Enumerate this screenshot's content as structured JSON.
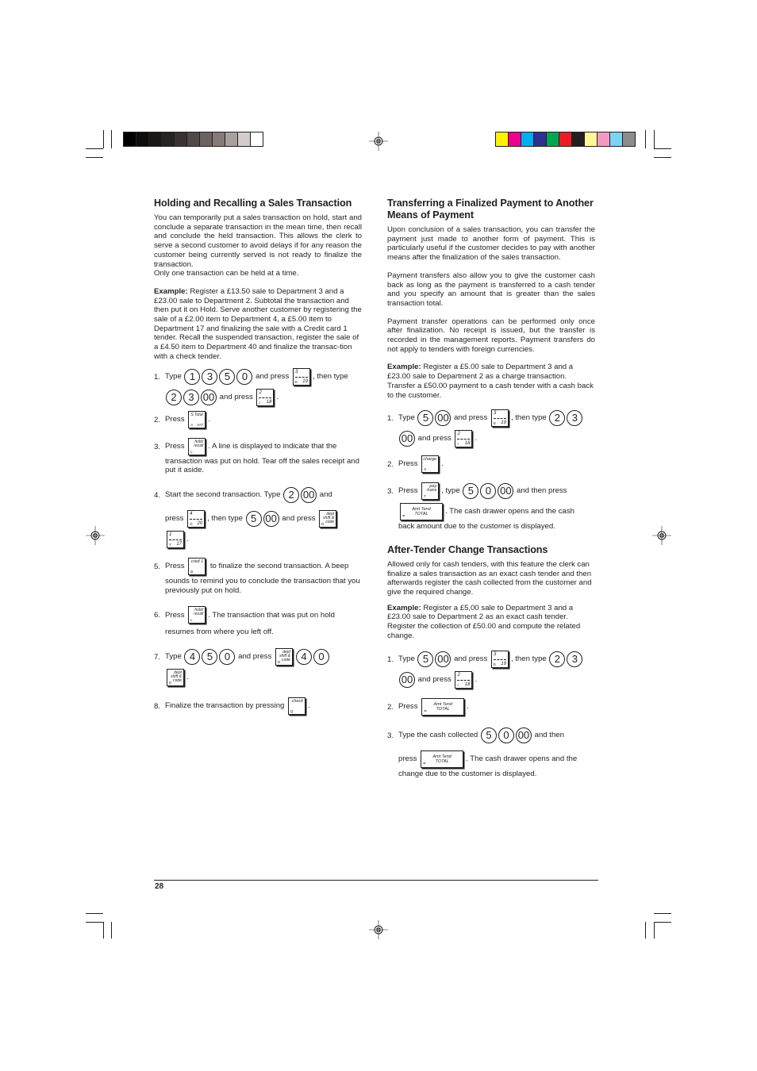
{
  "page": {
    "number": "28"
  },
  "print_marks": {
    "gray_swatches": [
      "#000000",
      "#0e0c0c",
      "#1a1715",
      "#272320",
      "#393331",
      "#514947",
      "#6c6360",
      "#857b78",
      "#a7a09d",
      "#d4cdcb",
      "#ffffff"
    ],
    "color_swatches": [
      "#fff200",
      "#ec008c",
      "#00aeef",
      "#2e3192",
      "#00a651",
      "#ed1c24",
      "#231f20",
      "#fff799",
      "#f49ac1",
      "#7dd3f7",
      "#8d8b8c"
    ]
  },
  "left": {
    "heading": "Holding and Recalling a Sales Transaction",
    "intro": "You can temporarily put a sales transaction on hold, start and conclude a separate transaction in the mean time, then recall and conclude the held transaction. This allows the clerk to serve a second customer to avoid delays if for any reason the customer being currently served is not ready to finalize the transaction.",
    "intro2": "Only one transaction can be held at a time.",
    "example_label": "Example:",
    "example_text": " Register a £13.50 sale to Department 3 and a £23.00 sale to Department 2. Subtotal the transaction and then put it on Hold. Serve another customer by registering the sale of a £2.00 item to Department 4, a £5.00 item to Department 17 and finalizing the sale with a Credit card 1 tender. Recall the suspended transaction, register the sale of a £4.50 item to Department 40 and finalize the transac-tion with a check tender.",
    "steps": {
      "s1": {
        "num": "1.",
        "a": "Type ",
        "keys1": [
          "1",
          "3",
          "5",
          "0"
        ],
        "b": " and press ",
        "c": ", then type",
        "keys2": [
          "2",
          "3",
          "00"
        ],
        "d": " and press ",
        "e": "."
      },
      "s2": {
        "num": "2.",
        "a": "Press ",
        "b": "."
      },
      "s3": {
        "num": "3.",
        "a": "Press ",
        "b": ". A line is displayed to indicate that the",
        "c": "transaction was put on hold. Tear off the sales receipt and put it aside."
      },
      "s4": {
        "num": "4.",
        "a": "Start the second transaction. Type ",
        "keys1": [
          "2",
          "00"
        ],
        "b": " and",
        "c": "press ",
        "d": ", then type ",
        "keys2": [
          "5",
          "00"
        ],
        "e": " and press ",
        "f": "."
      },
      "s5": {
        "num": "5.",
        "a": "Press ",
        "b": " to finalize the second transaction. A beep",
        "c": "sounds to remind you to conclude the transaction that you previously put on hold."
      },
      "s6": {
        "num": "6.",
        "a": "Press ",
        "b": ". The transaction that was put on hold",
        "c": "resumes from where you left off."
      },
      "s7": {
        "num": "7.",
        "a": "Type ",
        "keys1": [
          "4",
          "5",
          "0"
        ],
        "b": " and press ",
        "keys2": [
          "4",
          "0"
        ],
        "c": "."
      },
      "s8": {
        "num": "8.",
        "a": "Finalize the transaction by pressing ",
        "b": "."
      }
    }
  },
  "right": {
    "heading": "Transferring a Finalized Payment to Another Means of Payment",
    "p1": "Upon conclusion of a sales transaction, you can transfer the payment just made to another form of payment. This is particularly useful if the customer decides to pay with another means after the finalization of the sales transaction.",
    "p2": "Payment transfers also allow you to give the customer cash back as long as the payment is transferred to a cash tender and you specify an amount that is greater than the sales transaction total.",
    "p3": "Payment transfer operations can be performed only once after finalization. No receipt is issued, but the transfer is recorded in the management reports. Payment transfers do not apply to tenders with foreign currencies.",
    "example_label": "Example:",
    "example_text": " Register a £5.00 sale to Department 3 and a £23.00 sale to Department 2 as a charge transaction. Transfer a £50.00 payment to a cash tender with a cash back to the customer.",
    "steps": {
      "s1": {
        "num": "1.",
        "a": "Type ",
        "keys1": [
          "5",
          "00"
        ],
        "b": " and press ",
        "c": ", then type ",
        "keys2": [
          "2",
          "3"
        ],
        "keys3": [
          "00"
        ],
        "d": " and press ",
        "e": "."
      },
      "s2": {
        "num": "2.",
        "a": "Press ",
        "b": "."
      },
      "s3": {
        "num": "3.",
        "a": "Press ",
        "b": ", type ",
        "keys1": [
          "5",
          "0",
          "00"
        ],
        "c": " and then press",
        "d": ". The cash drawer opens and the cash",
        "e": "back amount due to the customer is displayed."
      }
    },
    "heading2": "After-Tender Change Transactions",
    "p4": "Allowed only for cash tenders, with this feature the clerk can finalize a sales transaction as an exact cash tender and then afterwards register the cash collected from the customer and give the required change.",
    "example2_label": "Example:",
    "example2_text": " Register a £5,00 sale to Department 3 and a £23.00 sale to Department 2 as an exact cash tender. Register the collection of £50.00 and compute the related change.",
    "steps2": {
      "s1": {
        "num": "1.",
        "a": "Type ",
        "keys1": [
          "5",
          "00"
        ],
        "b": " and press ",
        "c": ", then type ",
        "keys2": [
          "2",
          "3"
        ],
        "keys3": [
          "00"
        ],
        "d": " and press ",
        "e": "."
      },
      "s2": {
        "num": "2.",
        "a": "Press ",
        "b": "."
      },
      "s3": {
        "num": "3.",
        "a": "Type the cash collected ",
        "keys1": [
          "5",
          "0",
          "00"
        ],
        "b": " and then",
        "c": "press ",
        "d": ". The cash drawer opens and the",
        "e": "change due to the customer is displayed."
      }
    }
  },
  "function_keys": {
    "dept3": {
      "top": "3",
      "bottom_left": "E",
      "bottom_right": "19"
    },
    "dept2": {
      "top": "2",
      "bottom_left": "I",
      "bottom_right": "18"
    },
    "dept4": {
      "top": "4",
      "bottom_left": "G",
      "bottom_right": "20"
    },
    "dept1": {
      "top": "1",
      "bottom_left": "Y",
      "bottom_right": "17"
    },
    "subtotal": {
      "top": "S.Total",
      "bottom_left": "A",
      "bottom_right": "VAT"
    },
    "hold_recall": {
      "top": "hold/ recall",
      "bottom_left": "L"
    },
    "dept_shift": {
      "top": "dept shift & code",
      "bottom_left": "D"
    },
    "cred1": {
      "top": "cred 1",
      "bottom_left": "B"
    },
    "check": {
      "top": "check",
      "bottom_left": "Q"
    },
    "charge": {
      "top": "charge",
      "bottom_left": "X"
    },
    "pay_trans": {
      "top": "pay trans",
      "bottom_left": "T"
    },
    "amt_tend": {
      "top": "Amt Tend",
      "middle": "TOTAL",
      "bottom_left": "="
    }
  }
}
